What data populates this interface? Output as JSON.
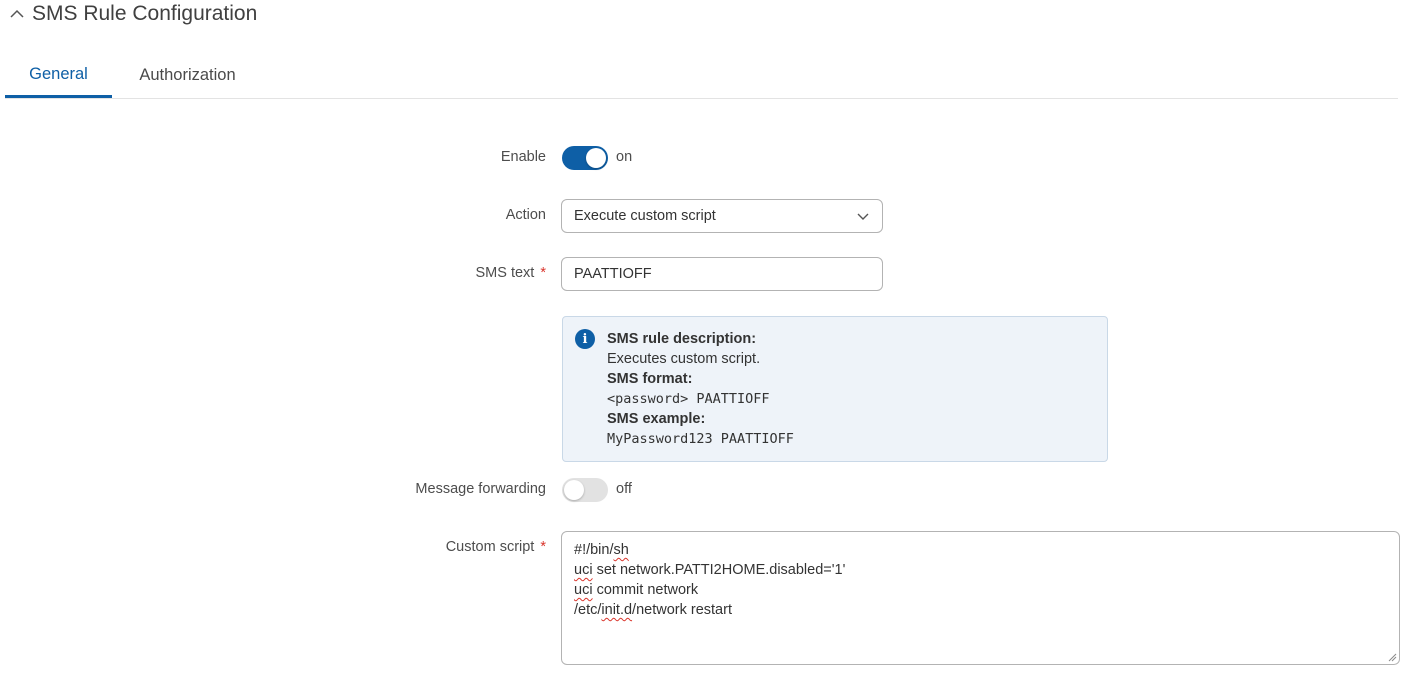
{
  "section": {
    "title": "SMS Rule Configuration",
    "icon": "chevron-up-icon"
  },
  "tabs": [
    {
      "label": "General",
      "active": true
    },
    {
      "label": "Authorization",
      "active": false
    }
  ],
  "form": {
    "enable": {
      "label": "Enable",
      "state": "on",
      "checked": true
    },
    "action": {
      "label": "Action",
      "value": "Execute custom script"
    },
    "sms_text": {
      "label": "SMS text",
      "required_mark": "*",
      "value": "PAATTIOFF"
    },
    "info": {
      "desc_title": "SMS rule description:",
      "desc": "Executes custom script.",
      "format_title": "SMS format:",
      "format": "<password> PAATTIOFF",
      "example_title": "SMS example:",
      "example": "MyPassword123 PAATTIOFF"
    },
    "message_forwarding": {
      "label": "Message forwarding",
      "state": "off",
      "checked": false
    },
    "custom_script": {
      "label": "Custom script",
      "required_mark": "*",
      "lines": [
        {
          "a": "#!/bin/",
          "b": "sh",
          "c": ""
        },
        {
          "a": "",
          "b": "uci",
          "c": " set network.PATTI2HOME.disabled='1'"
        },
        {
          "a": "",
          "b": "uci",
          "c": " commit network"
        },
        {
          "a": "/etc/",
          "b": "init.d",
          "c": "/network restart"
        }
      ]
    }
  },
  "colors": {
    "accent": "#0e5fa6",
    "required": "#d9342b"
  }
}
